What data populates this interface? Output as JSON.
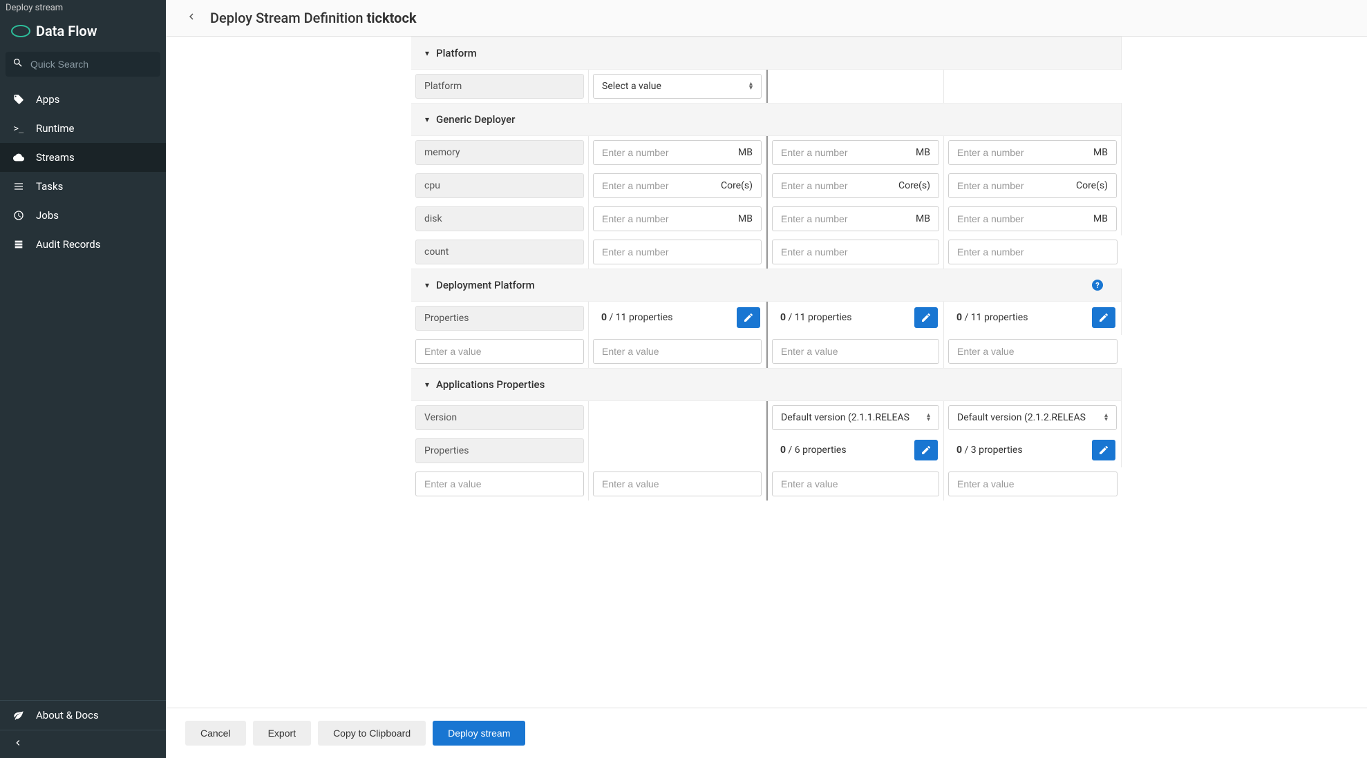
{
  "tabLabel": "Deploy stream",
  "brand": "Data Flow",
  "search": {
    "placeholder": "Quick Search"
  },
  "nav": {
    "apps": "Apps",
    "runtime": "Runtime",
    "streams": "Streams",
    "tasks": "Tasks",
    "jobs": "Jobs",
    "audit": "Audit Records",
    "about": "About & Docs"
  },
  "header": {
    "prefix": "Deploy Stream Definition ",
    "name": "ticktock"
  },
  "sections": {
    "platform": "Platform",
    "generic": "Generic Deployer",
    "deployment": "Deployment Platform",
    "appprops": "Applications Properties"
  },
  "labels": {
    "platform": "Platform",
    "memory": "memory",
    "cpu": "cpu",
    "disk": "disk",
    "count": "count",
    "properties": "Properties",
    "version": "Version"
  },
  "placeholders": {
    "selectValue": "Select a value",
    "enterNumber": "Enter a number",
    "enterValue": "Enter a value"
  },
  "units": {
    "mb": "MB",
    "cores": "Core(s)"
  },
  "props": {
    "zero": "0",
    "sep": " / ",
    "eleven": "11 properties",
    "six": "6 properties",
    "three": "3 properties"
  },
  "versions": {
    "v211": "Default version (2.1.1.RELEAS",
    "v212": "Default version (2.1.2.RELEAS"
  },
  "buttons": {
    "cancel": "Cancel",
    "export": "Export",
    "copy": "Copy to Clipboard",
    "deploy": "Deploy stream"
  }
}
